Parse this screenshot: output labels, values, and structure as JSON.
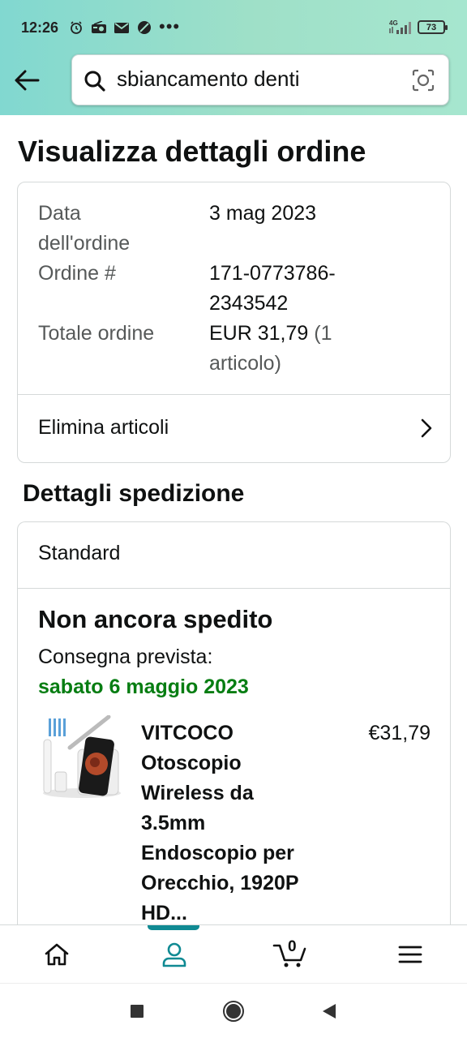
{
  "status_bar": {
    "time": "12:26",
    "network_label": "4G",
    "battery": "73"
  },
  "search": {
    "query": "sbiancamento denti"
  },
  "page": {
    "title": "Visualizza dettagli ordine"
  },
  "order_summary": {
    "date_label_line1": "Data",
    "date_label_line2": "dell'ordine",
    "date_value": "3 mag 2023",
    "order_label": "Ordine #",
    "order_value_line1": "171-0773786-",
    "order_value_line2": "2343542",
    "total_label": "Totale ordine",
    "total_value_line1": "EUR 31,79",
    "total_value_suffix": " (1",
    "total_value_line2": "articolo)",
    "remove_items_label": "Elimina articoli"
  },
  "shipping": {
    "section_title": "Dettagli spedizione",
    "method": "Standard",
    "status": "Non ancora spedito",
    "delivery_label": "Consegna prevista:",
    "delivery_date": "sabato 6 maggio 2023",
    "product": {
      "title_lines": [
        "VITCOCO",
        "Otoscopio",
        "Wireless da",
        "3.5mm",
        "Endoscopio per",
        "Orecchio, 1920P",
        "HD..."
      ],
      "price": "€31,79"
    }
  },
  "bottom_nav": {
    "cart_count": "0",
    "active": "account"
  },
  "colors": {
    "header_gradient_start": "#81d8d0",
    "header_gradient_end": "#a6e6cf",
    "delivery_green": "#067d12",
    "active_teal": "#108a93",
    "border": "#d5d9d9"
  }
}
